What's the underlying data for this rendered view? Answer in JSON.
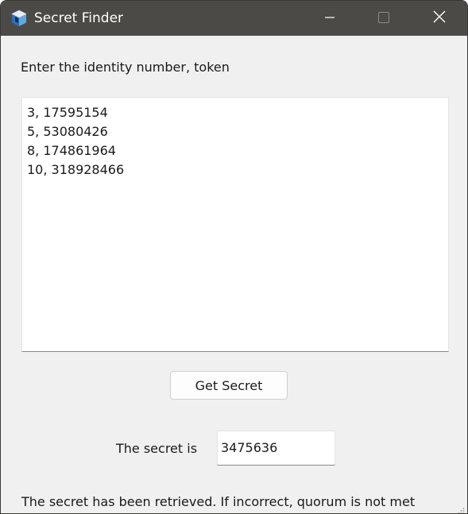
{
  "window": {
    "title": "Secret Finder",
    "app_icon": "cube-app-icon",
    "controls": {
      "minimize_icon": "minimize-icon",
      "maximize_icon": "maximize-icon",
      "close_icon": "close-icon"
    },
    "titlebar_color": "#4b4a47",
    "background_color": "#f0f0f0"
  },
  "form": {
    "prompt_label": "Enter the identity number, token",
    "input_lines": [
      "3, 17595154",
      "5, 53080426",
      "8, 174861964",
      "10, 318928466"
    ],
    "get_secret_label": "Get Secret",
    "secret_label": "The secret is",
    "secret_value": "3475636"
  },
  "status": {
    "message": "The secret has been retrieved. If incorrect, quorum is not met"
  }
}
